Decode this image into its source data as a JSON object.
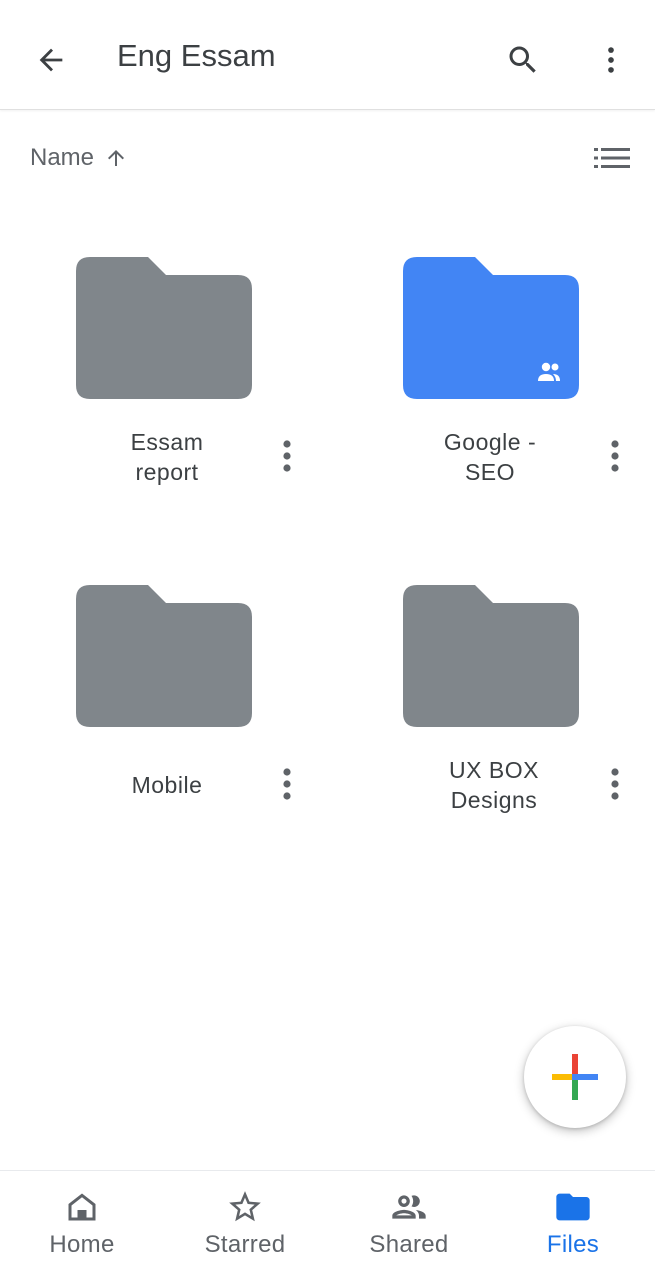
{
  "header": {
    "title": "Eng Essam",
    "back_icon": "arrow-back-icon",
    "search_icon": "search-icon",
    "more_icon": "more-vert-icon"
  },
  "sort": {
    "label": "Name",
    "direction_icon": "arrow-up-icon",
    "view_icon": "list-view-icon"
  },
  "folders": [
    {
      "name_line1": "Essam",
      "name_line2": "report",
      "shared": false,
      "color": "#80868b"
    },
    {
      "name_line1": "Google -",
      "name_line2": "SEO",
      "shared": true,
      "color": "#4285f4"
    },
    {
      "name_line1": "Mobile",
      "name_line2": "",
      "shared": false,
      "color": "#80868b"
    },
    {
      "name_line1": "UX BOX",
      "name_line2": "Designs",
      "shared": false,
      "color": "#80868b"
    }
  ],
  "fab": {
    "icon": "google-plus-icon"
  },
  "bottom_nav": {
    "items": [
      {
        "label": "Home",
        "icon": "home-icon",
        "active": false
      },
      {
        "label": "Starred",
        "icon": "star-icon",
        "active": false
      },
      {
        "label": "Shared",
        "icon": "shared-people-icon",
        "active": false
      },
      {
        "label": "Files",
        "icon": "folder-icon",
        "active": true
      }
    ]
  },
  "colors": {
    "accent": "#1a73e8",
    "folder_gray": "#80868b",
    "folder_blue": "#4285f4",
    "text": "#3c4043",
    "google_red": "#ea4335",
    "google_blue": "#4285f4",
    "google_yellow": "#fbbc04",
    "google_green": "#34a853"
  }
}
